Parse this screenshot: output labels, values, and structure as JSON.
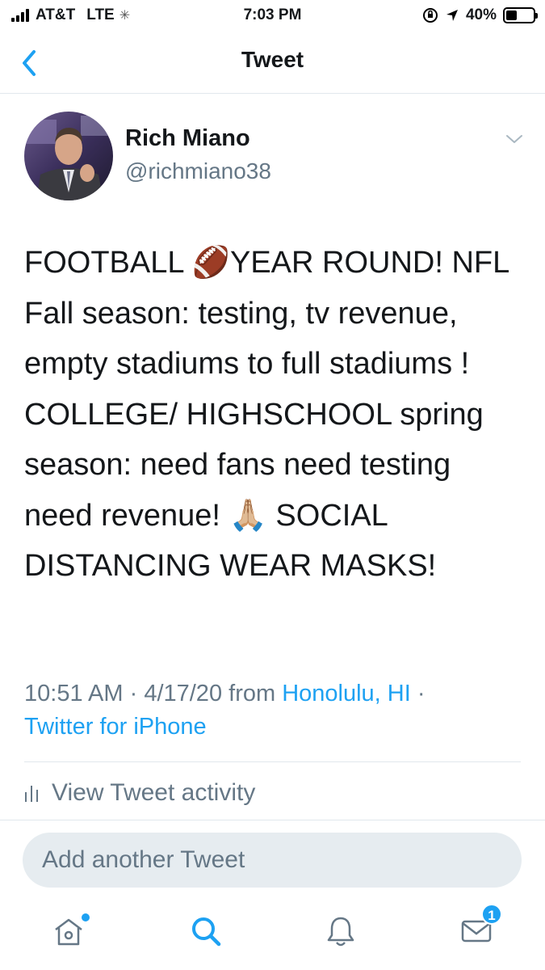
{
  "status_bar": {
    "carrier": "AT&T",
    "network": "LTE",
    "time": "7:03 PM",
    "battery": "40%",
    "battery_level": 0.4
  },
  "nav": {
    "title": "Tweet",
    "back_icon": "chevron-left-icon"
  },
  "tweet": {
    "author_name": "Rich Miano",
    "author_handle": "@richmiano38",
    "text_parts": [
      "FOOTBALL ",
      "🏈",
      "YEAR ROUND! NFL Fall season: testing, tv revenue, empty stadiums to full stadiums ! COLLEGE/ HIGHSCHOOL spring season: need fans need testing need revenue! ",
      "🙏🏼",
      " SOCIAL DISTANCING WEAR MASKS!"
    ],
    "time": "10:51 AM",
    "sep1": " · ",
    "date": "4/17/20",
    "from": " from ",
    "location": "Honolulu, HI",
    "sep2": " · ",
    "source": "Twitter for iPhone"
  },
  "activity": {
    "label": "View Tweet activity"
  },
  "reply": {
    "placeholder": "Add another Tweet"
  },
  "tab_bar": {
    "messages_badge": "1",
    "accent": "#1da1f2"
  },
  "colors": {
    "accent": "#1da1f2",
    "secondary_text": "#657786",
    "divider": "#e1e8ed"
  }
}
